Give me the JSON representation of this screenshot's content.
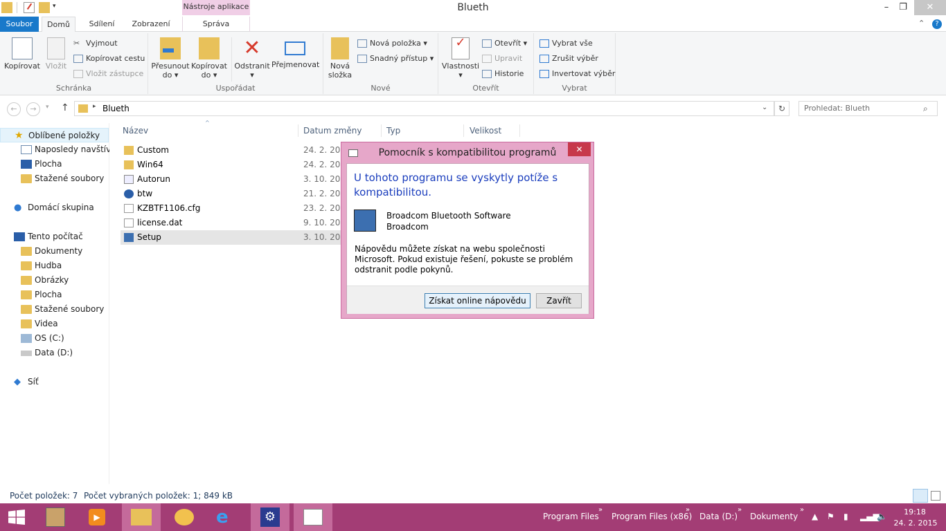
{
  "window": {
    "title": "Blueth",
    "tools_tab": "Nástroje aplikace",
    "minimize": "–",
    "maximize": "❐",
    "close": "✕"
  },
  "tabs": {
    "soubor": "Soubor",
    "domu": "Domů",
    "sdileni": "Sdílení",
    "zobrazeni": "Zobrazení",
    "sprava": "Správa"
  },
  "ribbon": {
    "schranka": {
      "label": "Schránka",
      "kopirovat": "Kopírovat",
      "vlozit": "Vložit",
      "vyjmout": "Vyjmout",
      "kopirovat_cestu": "Kopírovat cestu",
      "vlozit_zastupce": "Vložit zástupce"
    },
    "usporadat": {
      "label": "Uspořádat",
      "presunout": "Přesunout",
      "do": "do ▾",
      "kopirovat": "Kopírovat",
      "odstranit": "Odstranit",
      "odstranit_arrow": "▾",
      "prejmenovat": "Přejmenovat"
    },
    "nove": {
      "label": "Nové",
      "nova_slozka_1": "Nová",
      "nova_slozka_2": "složka",
      "nova_polozka": "Nová položka ▾",
      "snadny_pristup": "Snadný přístup ▾"
    },
    "otevrit": {
      "label": "Otevřít",
      "vlastnosti": "Vlastnosti",
      "vlastnosti_arrow": "▾",
      "otevrit": "Otevřít ▾",
      "upravit": "Upravit",
      "historie": "Historie"
    },
    "vybrat": {
      "label": "Vybrat",
      "vybrat_vse": "Vybrat vše",
      "zrusit_vyber": "Zrušit výběr",
      "invertovat_vyber": "Invertovat výběr"
    }
  },
  "address": {
    "path": "Blueth",
    "search_placeholder": "Prohledat: Blueth"
  },
  "nav": {
    "oblibene": "Oblíbené položky",
    "naposledy": "Naposledy navštívené",
    "plocha": "Plocha",
    "stazene": "Stažené soubory",
    "domaci": "Domácí skupina",
    "pocitac": "Tento počítač",
    "dokumenty": "Dokumenty",
    "hudba": "Hudba",
    "obrazky": "Obrázky",
    "plocha2": "Plocha",
    "stazene2": "Stažené soubory",
    "videa": "Videa",
    "osc": "OS (C:)",
    "datad": "Data (D:)",
    "sit": "Síť"
  },
  "columns": {
    "name": "Název",
    "date": "Datum změny",
    "type": "Typ",
    "size": "Velikost"
  },
  "files": [
    {
      "name": "Custom",
      "date": "24. 2. 2015"
    },
    {
      "name": "Win64",
      "date": "24. 2. 2015"
    },
    {
      "name": "Autorun",
      "date": "3. 10. 2009"
    },
    {
      "name": "btw",
      "date": "21. 2. 2009"
    },
    {
      "name": "KZBTF1106.cfg",
      "date": "23. 2. 2010"
    },
    {
      "name": "license.dat",
      "date": "9. 10. 2009"
    },
    {
      "name": "Setup",
      "date": "3. 10. 2009"
    }
  ],
  "dialog": {
    "title": "Pomocník s kompatibilitou programů",
    "heading": "U tohoto programu se vyskytly potíže s kompatibilitou.",
    "program": "Broadcom Bluetooth Software",
    "publisher": "Broadcom",
    "body": "Nápovědu můžete získat na webu společnosti Microsoft. Pokud existuje řešení, pokuste se problém odstranit podle pokynů.",
    "btn_online": "Získat online nápovědu",
    "btn_close": "Zavřít"
  },
  "status": {
    "count": "Počet položek: 7",
    "selected": "Počet vybraných položek: 1; 849 kB"
  },
  "taskbar": {
    "toolbars": [
      "Program Files",
      "Program Files (x86)",
      "Data (D:)",
      "Dokumenty"
    ],
    "time": "19:18",
    "date": "24. 2. 2015"
  },
  "colors": {
    "accent": "#1979ca",
    "taskbar": "#a33d75",
    "dialog_frame": "#e6a7c9",
    "tools_tab": "#f0cee6"
  }
}
